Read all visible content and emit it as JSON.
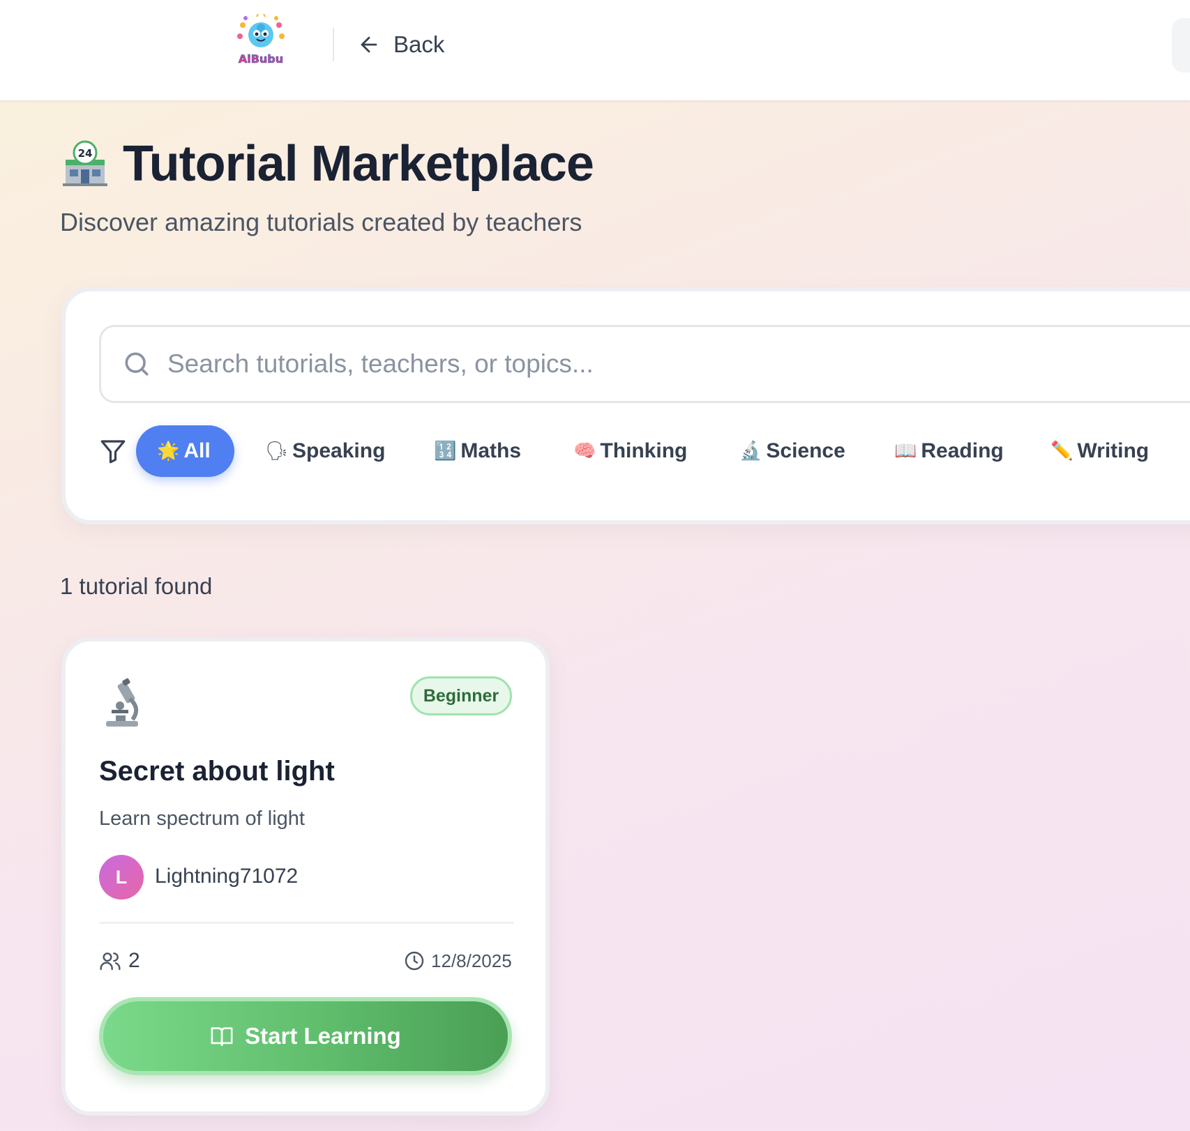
{
  "header": {
    "logo_text": "AiBubu",
    "back_label": "Back"
  },
  "hero": {
    "emoji": "convenience-store-24-emoji",
    "title": "Tutorial Marketplace",
    "subtitle": "Discover amazing tutorials created by teachers"
  },
  "search": {
    "placeholder": "Search tutorials, teachers, or topics...",
    "value": ""
  },
  "filters": [
    {
      "emoji": "🌟",
      "label": "All",
      "active": true
    },
    {
      "emoji": "🗣",
      "label": "Speaking",
      "active": false
    },
    {
      "emoji": "🔢",
      "label": "Maths",
      "active": false
    },
    {
      "emoji": "🧠",
      "label": "Thinking",
      "active": false
    },
    {
      "emoji": "🔬",
      "label": "Science",
      "active": false
    },
    {
      "emoji": "📖",
      "label": "Reading",
      "active": false
    },
    {
      "emoji": "✏️",
      "label": "Writing",
      "active": false
    }
  ],
  "results": {
    "count_text": "1 tutorial found"
  },
  "tutorials": [
    {
      "emoji": "microscope-emoji",
      "level": "Beginner",
      "title": "Secret about light",
      "description": "Learn spectrum of light",
      "author_initial": "L",
      "author": "Lightning71072",
      "learners": "2",
      "date": "12/8/2025",
      "cta_label": "Start Learning"
    }
  ],
  "colors": {
    "accent_blue": "#4f7ff0",
    "cta_green": "#5fbd6c",
    "badge_green_bg": "#e7f8ea",
    "badge_green_text": "#2f6b3a",
    "avatar_gradient_start": "#c96be0",
    "avatar_gradient_end": "#e666a5"
  }
}
